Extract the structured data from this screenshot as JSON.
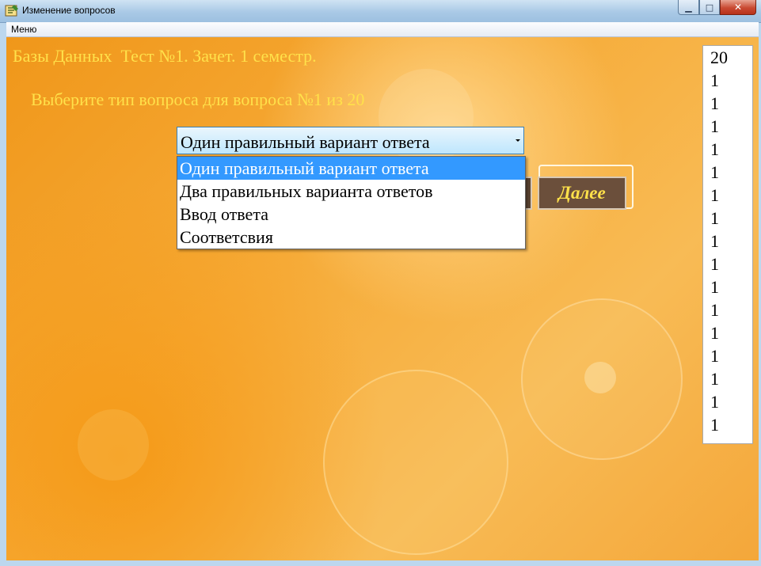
{
  "window": {
    "title": "Изменение вопросов",
    "buttons": {
      "minimize": "▁",
      "maximize": "□",
      "close": "✕"
    }
  },
  "menubar": {
    "items": [
      "Меню"
    ]
  },
  "header": "Базы Данных  Тест №1. Зачет. 1 семестр.",
  "prompt": "Выберите тип вопроса для вопроса №1 из 20",
  "question_type": {
    "selected": "Один правильный вариант ответа",
    "options": [
      "Один правильный вариант ответа",
      "Два правильных варианта ответов",
      "Ввод ответа",
      "Соответсвия"
    ],
    "highlighted_index": 0
  },
  "next_button": "Далее",
  "listbox": {
    "items": [
      "20",
      "1",
      "1",
      "1",
      "1",
      "1",
      "1",
      "1",
      "1",
      "1",
      "1",
      "1",
      "1",
      "1",
      "1",
      "1",
      "1"
    ]
  },
  "colors": {
    "accent_text": "#ffe14a",
    "selection": "#3399ff",
    "button_bg": "#6b4f3b"
  },
  "icons": {
    "app": "app-icon"
  }
}
